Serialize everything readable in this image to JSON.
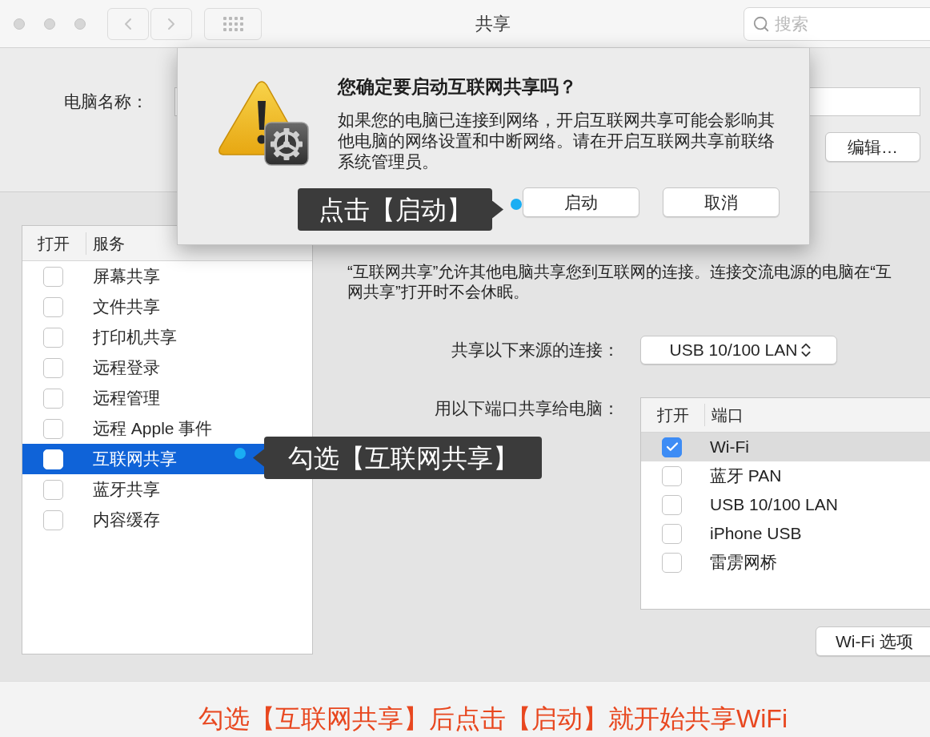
{
  "window": {
    "title": "共享",
    "search": {
      "placeholder": "搜索"
    }
  },
  "computer_name": {
    "label": "电脑名称：",
    "edit_button": "编辑…"
  },
  "services": {
    "columns": [
      "打开",
      "服务"
    ],
    "items": [
      {
        "name": "屏幕共享",
        "checked": false,
        "selected": false
      },
      {
        "name": "文件共享",
        "checked": false,
        "selected": false
      },
      {
        "name": "打印机共享",
        "checked": false,
        "selected": false
      },
      {
        "name": "远程登录",
        "checked": false,
        "selected": false
      },
      {
        "name": "远程管理",
        "checked": false,
        "selected": false
      },
      {
        "name": "远程 Apple 事件",
        "checked": false,
        "selected": false
      },
      {
        "name": "互联网共享",
        "checked": false,
        "selected": true
      },
      {
        "name": "蓝牙共享",
        "checked": false,
        "selected": false
      },
      {
        "name": "内容缓存",
        "checked": false,
        "selected": false
      }
    ]
  },
  "internet_sharing": {
    "description": [
      "“互联网共享”允许其他电脑共享您到互联网的连接。连接交流电源的电脑在“互",
      "网共享”打开时不会休眠。"
    ],
    "source_label": "共享以下来源的连接：",
    "source_value": "USB 10/100 LAN",
    "ports_label": "用以下端口共享给电脑：",
    "ports_columns": [
      "打开",
      "端口"
    ],
    "ports": [
      {
        "name": "Wi-Fi",
        "checked": true,
        "selected": true
      },
      {
        "name": "蓝牙 PAN",
        "checked": false,
        "selected": false
      },
      {
        "name": "USB 10/100 LAN",
        "checked": false,
        "selected": false
      },
      {
        "name": "iPhone USB",
        "checked": false,
        "selected": false
      },
      {
        "name": "雷雳网桥",
        "checked": false,
        "selected": false
      }
    ],
    "options_button": "Wi-Fi 选项"
  },
  "dialog": {
    "title": "您确定要启动互联网共享吗？",
    "message": [
      "如果您的电脑已连接到网络，开启互联网共享可能会影响其",
      "他电脑的网络设置和中断网络。请在开启互联网共享前联络",
      "系统管理员。"
    ],
    "buttons": [
      "启动",
      "取消"
    ]
  },
  "annotations": [
    {
      "text": "点击【启动】"
    },
    {
      "text": "勾选【互联网共享】"
    }
  ],
  "caption": "勾选【互联网共享】后点击【启动】就开始共享WiFi"
}
